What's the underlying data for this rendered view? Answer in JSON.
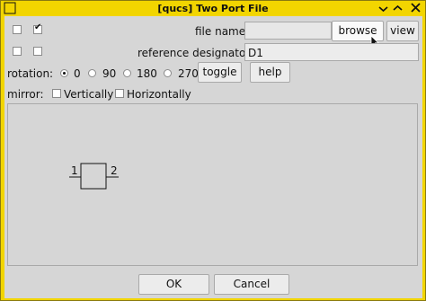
{
  "window": {
    "title": "[qucs] Two Port File"
  },
  "checkboxes_top": [
    {
      "checked": false
    },
    {
      "checked": true
    }
  ],
  "checkboxes_second": [
    {
      "checked": false
    },
    {
      "checked": false
    }
  ],
  "file": {
    "label": "file name:",
    "value": "",
    "browse_label": "browse",
    "view_label": "view"
  },
  "designator": {
    "label": "reference designator:",
    "value": "D1"
  },
  "rotation": {
    "label": "rotation:",
    "options": [
      "0",
      "90",
      "180",
      "270"
    ],
    "selected": "0",
    "toggle_label": "toggle",
    "help_label": "help"
  },
  "mirror": {
    "label": "mirror:",
    "vertical_label": "Vertically",
    "horizontal_label": "Horizontally"
  },
  "preview": {
    "port1": "1",
    "port2": "2"
  },
  "footer": {
    "ok_label": "OK",
    "cancel_label": "Cancel"
  }
}
